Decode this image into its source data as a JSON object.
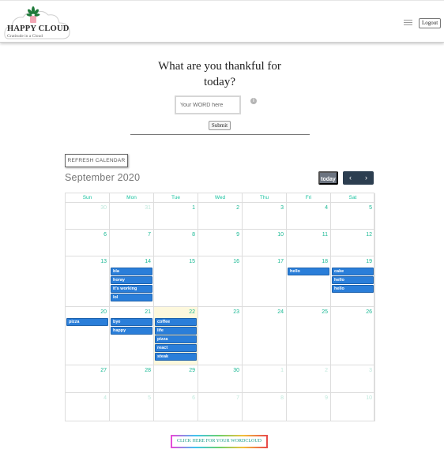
{
  "header": {
    "logo_title": "HAPPY CLOUD",
    "logo_subtitle": "Gratitude in a Cloud",
    "logout_label": "Logout"
  },
  "form": {
    "question": "What are you thankful for today?",
    "input_placeholder": "Your WORD here",
    "input_value": "",
    "info_icon": "i",
    "submit_label": "Submit"
  },
  "calendar": {
    "refresh_label": "REFRESH CALENDAR",
    "month_title": "September 2020",
    "today_label": "today",
    "prev_label": "‹",
    "next_label": "›",
    "weekdays": [
      "Sun",
      "Mon",
      "Tue",
      "Wed",
      "Thu",
      "Fri",
      "Sat"
    ],
    "weeks": [
      [
        {
          "day": "30",
          "other": true,
          "events": []
        },
        {
          "day": "31",
          "other": true,
          "events": []
        },
        {
          "day": "1",
          "events": []
        },
        {
          "day": "2",
          "events": []
        },
        {
          "day": "3",
          "events": []
        },
        {
          "day": "4",
          "events": []
        },
        {
          "day": "5",
          "events": []
        }
      ],
      [
        {
          "day": "6",
          "events": []
        },
        {
          "day": "7",
          "events": []
        },
        {
          "day": "8",
          "events": []
        },
        {
          "day": "9",
          "events": []
        },
        {
          "day": "10",
          "events": []
        },
        {
          "day": "11",
          "events": []
        },
        {
          "day": "12",
          "events": []
        }
      ],
      [
        {
          "day": "13",
          "events": []
        },
        {
          "day": "14",
          "events": [
            "bla",
            "horay",
            "it's working",
            "lol"
          ]
        },
        {
          "day": "15",
          "events": []
        },
        {
          "day": "16",
          "events": []
        },
        {
          "day": "17",
          "events": []
        },
        {
          "day": "18",
          "events": [
            "hello"
          ]
        },
        {
          "day": "19",
          "events": [
            "cake",
            "hello",
            "hello"
          ]
        }
      ],
      [
        {
          "day": "20",
          "events": [
            "pizza"
          ]
        },
        {
          "day": "21",
          "events": [
            "bye",
            "happy"
          ]
        },
        {
          "day": "22",
          "today": true,
          "events": [
            "coffee",
            "life",
            "pizza",
            "react",
            "steak"
          ]
        },
        {
          "day": "23",
          "events": []
        },
        {
          "day": "24",
          "events": []
        },
        {
          "day": "25",
          "events": []
        },
        {
          "day": "26",
          "events": []
        }
      ],
      [
        {
          "day": "27",
          "events": []
        },
        {
          "day": "28",
          "events": []
        },
        {
          "day": "29",
          "events": []
        },
        {
          "day": "30",
          "events": []
        },
        {
          "day": "1",
          "other": true,
          "events": []
        },
        {
          "day": "2",
          "other": true,
          "events": []
        },
        {
          "day": "3",
          "other": true,
          "events": []
        }
      ],
      [
        {
          "day": "4",
          "other": true,
          "events": []
        },
        {
          "day": "5",
          "other": true,
          "events": []
        },
        {
          "day": "6",
          "other": true,
          "events": []
        },
        {
          "day": "7",
          "other": true,
          "events": []
        },
        {
          "day": "8",
          "other": true,
          "events": []
        },
        {
          "day": "9",
          "other": true,
          "events": []
        },
        {
          "day": "10",
          "other": true,
          "events": []
        }
      ]
    ]
  },
  "footer": {
    "wordcloud_label": "CLICK HERE FOR YOUR WORDCLOUD"
  },
  "colors": {
    "accent_teal": "#19c3a0",
    "event_blue": "#2a7ed9",
    "today_highlight": "#fdf8dd",
    "nav_dark": "#2c3e50"
  }
}
